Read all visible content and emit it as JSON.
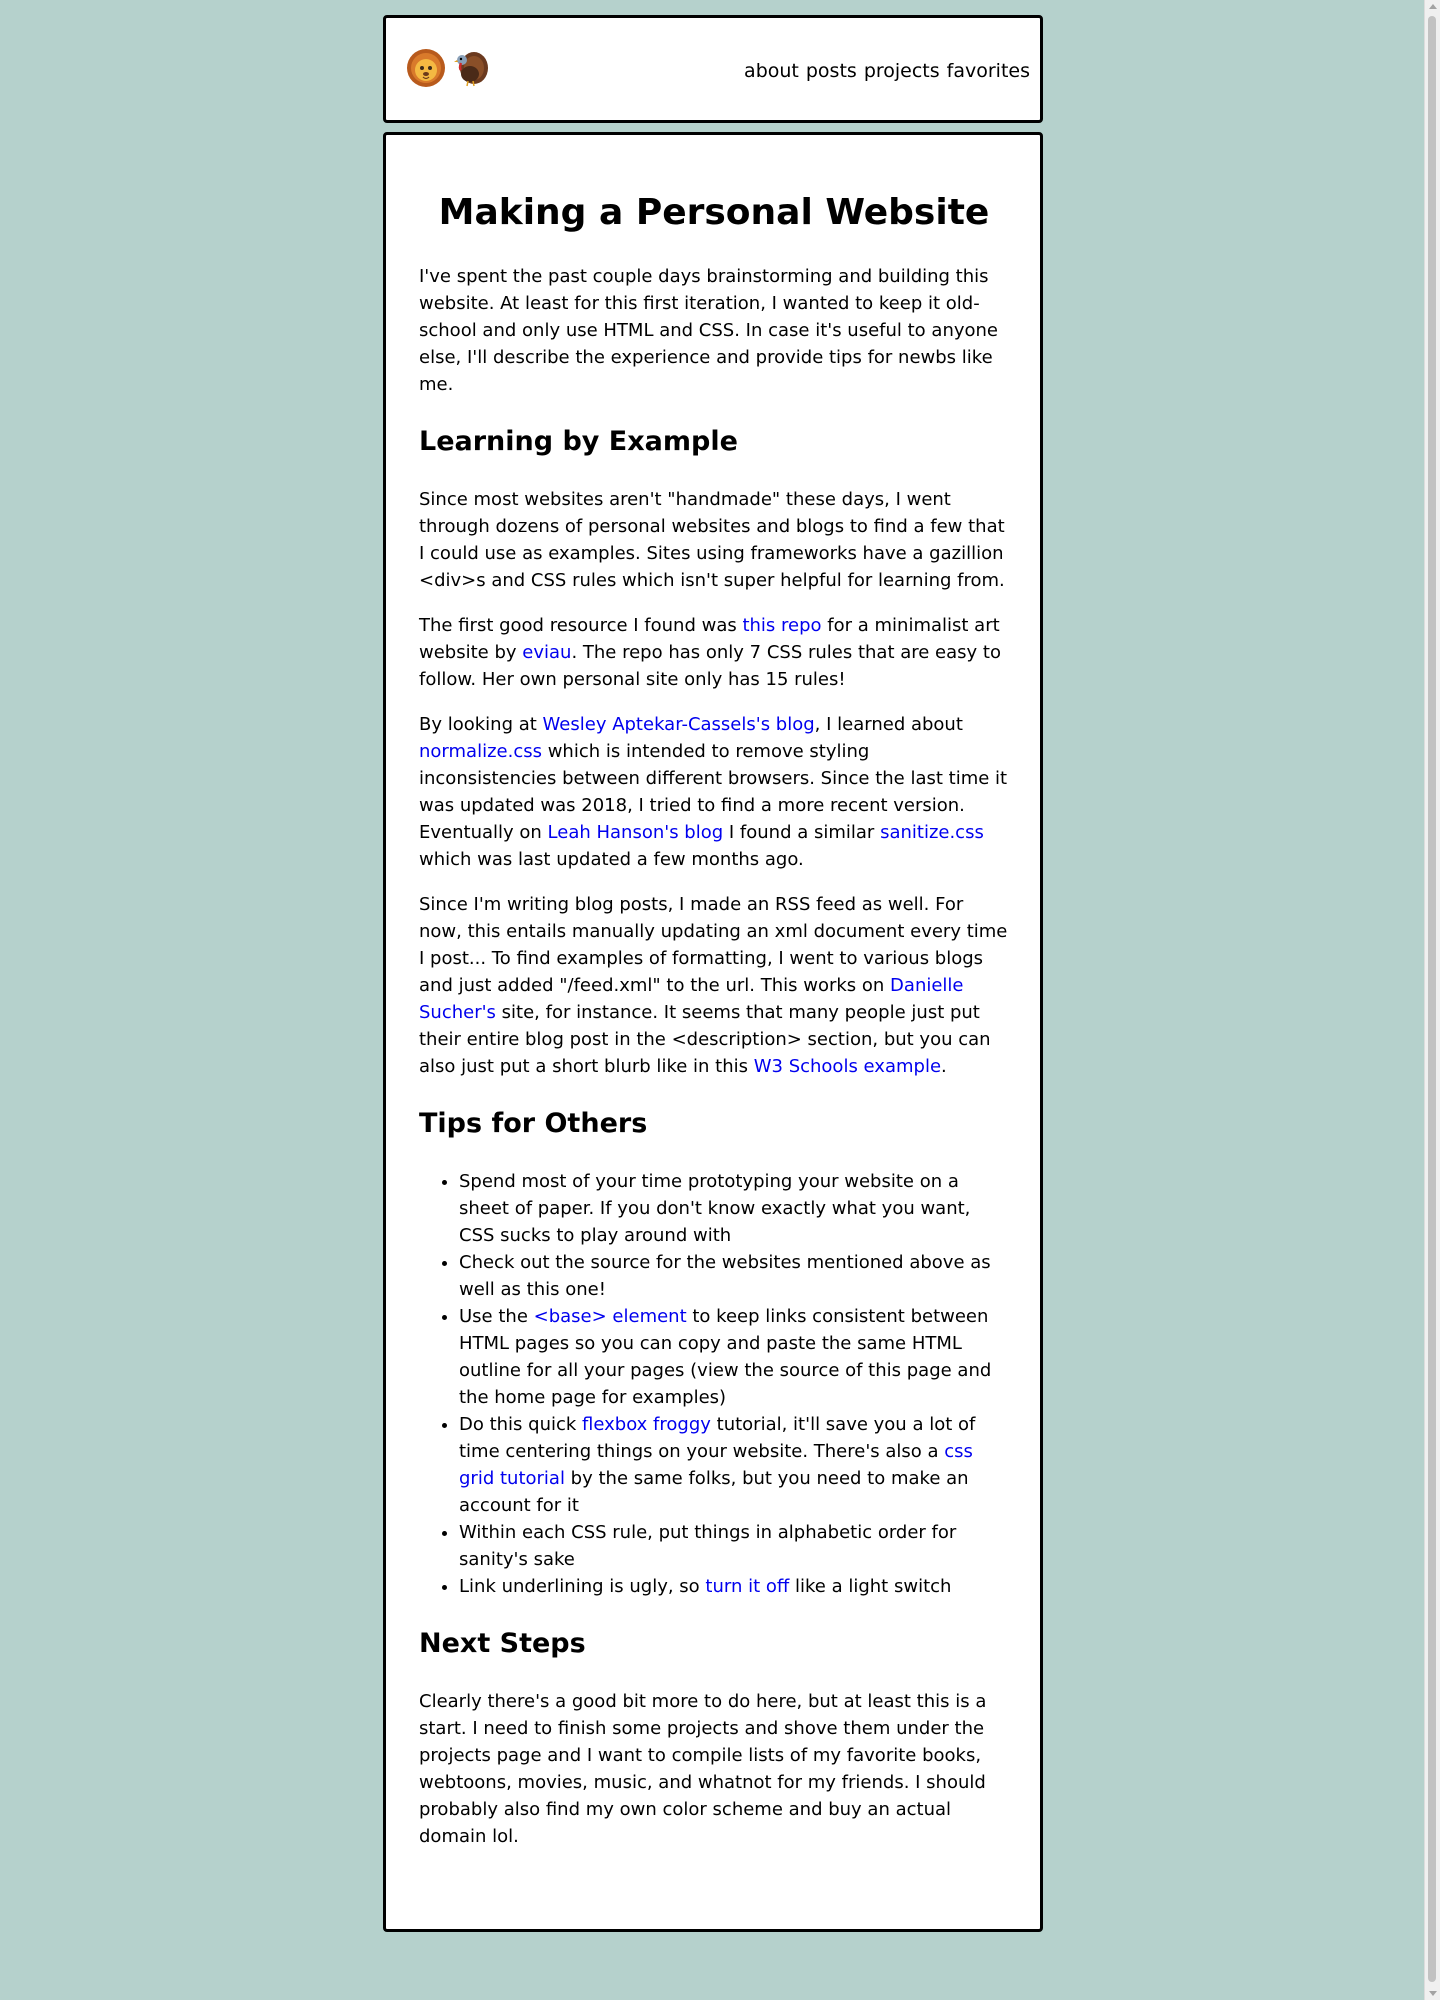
{
  "nav": {
    "logo": {
      "lion": "lion-emoji",
      "turkey": "turkey-emoji"
    },
    "links": [
      "about",
      "posts",
      "projects",
      "favorites"
    ]
  },
  "article": {
    "title": "Making a Personal Website",
    "intro": "I've spent the past couple days brainstorming and building this website. At least for this first iteration, I wanted to keep it old-school and only use HTML and CSS. In case it's useful to anyone else, I'll describe the experience and provide tips for newbs like me.",
    "s1": {
      "heading": "Learning by Example",
      "p1": "Since most websites aren't \"handmade\" these days, I went through dozens of personal websites and blogs to find a few that I could use as examples. Sites using frameworks have a gazillion <div>s and CSS rules which isn't super helpful for learning from.",
      "p2": {
        "t1": "The first good resource I found was ",
        "l1": "this repo",
        "t2": " for a minimalist art website by ",
        "l2": "eviau",
        "t3": ". The repo has only 7 CSS rules that are easy to follow. Her own personal site only has 15 rules!"
      },
      "p3": {
        "t1": "By looking at ",
        "l1": "Wesley Aptekar-Cassels's blog",
        "t2": ", I learned about ",
        "l2": "normalize.css",
        "t3": " which is intended to remove styling inconsistencies between different browsers. Since the last time it was updated was 2018, I tried to find a more recent version. Eventually on ",
        "l3": "Leah Hanson's blog",
        "t4": " I found a similar ",
        "l4": "sanitize.css",
        "t5": " which was last updated a few months ago."
      },
      "p4": {
        "t1": "Since I'm writing blog posts, I made an RSS feed as well. For now, this entails manually updating an xml document every time I post... To find examples of formatting, I went to various blogs and just added \"/feed.xml\" to the url. This works on ",
        "l1": "Danielle Sucher's",
        "t2": " site, for instance. It seems that many people just put their entire blog post in the <description> section, but you can also just put a short blurb like in this ",
        "l2": "W3 Schools example",
        "t3": "."
      }
    },
    "s2": {
      "heading": "Tips for Others",
      "tip1": "Spend most of your time prototyping your website on a sheet of paper. If you don't know exactly what you want, CSS sucks to play around with",
      "tip2": "Check out the source for the websites mentioned above as well as this one!",
      "tip3": {
        "t1": "Use the ",
        "l1": "<base> element",
        "t2": " to keep links consistent between HTML pages so you can copy and paste the same HTML outline for all your pages (view the source of this page and the home page for examples)"
      },
      "tip4": {
        "t1": "Do this quick ",
        "l1": "flexbox froggy",
        "t2": " tutorial, it'll save you a lot of time centering things on your website. There's also a ",
        "l2": "css grid tutorial",
        "t3": " by the same folks, but you need to make an account for it"
      },
      "tip5": "Within each CSS rule, put things in alphabetic order for sanity's sake",
      "tip6": {
        "t1": "Link underlining is ugly, so ",
        "l1": "turn it off",
        "t2": " like a light switch"
      }
    },
    "s3": {
      "heading": "Next Steps",
      "p1": "Clearly there's a good bit more to do here, but at least this is a start. I need to finish some projects and shove them under the projects page and I want to compile lists of my favorite books, webtoons, movies, music, and whatnot for my friends. I should probably also find my own color scheme and buy an actual domain lol."
    }
  },
  "colors": {
    "background": "#b5d1cc",
    "link": "#0000ee",
    "border": "#000000"
  }
}
